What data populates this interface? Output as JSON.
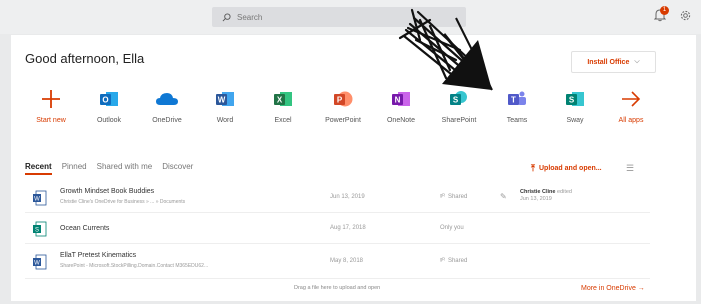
{
  "header": {
    "search_placeholder": "Search",
    "notification_count": "1"
  },
  "main": {
    "greeting": "Good afternoon, Ella",
    "install_label": "Install Office",
    "apps": [
      {
        "label": "Start new",
        "icon": "plus-icon",
        "color": "#d83b01"
      },
      {
        "label": "Outlook",
        "icon": "outlook-icon",
        "color": "#0f6cbd"
      },
      {
        "label": "OneDrive",
        "icon": "onedrive-icon",
        "color": "#0f78d4"
      },
      {
        "label": "Word",
        "icon": "word-icon",
        "color": "#2b579a"
      },
      {
        "label": "Excel",
        "icon": "excel-icon",
        "color": "#217346"
      },
      {
        "label": "PowerPoint",
        "icon": "powerpoint-icon",
        "color": "#d24726"
      },
      {
        "label": "OneNote",
        "icon": "onenote-icon",
        "color": "#7719aa"
      },
      {
        "label": "SharePoint",
        "icon": "sharepoint-icon",
        "color": "#038387"
      },
      {
        "label": "Teams",
        "icon": "teams-icon",
        "color": "#5059c9"
      },
      {
        "label": "Sway",
        "icon": "sway-icon",
        "color": "#008272"
      },
      {
        "label": "All apps",
        "icon": "arrow-right-icon",
        "color": "#d83b01"
      }
    ],
    "tabs": [
      {
        "label": "Recent"
      },
      {
        "label": "Pinned"
      },
      {
        "label": "Shared with me"
      },
      {
        "label": "Discover"
      }
    ],
    "upload_label": "Upload and open...",
    "files": [
      {
        "name": "Growth Mindset Book Buddies",
        "location": "Christie Cline's OneDrive for Business » ... » Documents",
        "date": "Jun 13, 2019",
        "sharing": "Shared",
        "activity_name": "Christie Cline",
        "activity_action": "edited",
        "activity_date": "Jun 13, 2019",
        "type": "word"
      },
      {
        "name": "Ocean Currents",
        "location": "",
        "date": "Aug 17, 2018",
        "sharing": "Only you",
        "activity_name": "",
        "activity_action": "",
        "activity_date": "",
        "type": "sway"
      },
      {
        "name": "EllaT Pretest Kinematics",
        "location": "SharePoint - Microsoft.StockPilling.Domain.Contact M365EDU62...",
        "date": "May 8, 2018",
        "sharing": "Shared",
        "activity_name": "",
        "activity_action": "",
        "activity_date": "",
        "type": "word"
      }
    ],
    "drop_hint": "Drag a file here to upload and open",
    "more_label": "More in OneDrive →"
  }
}
